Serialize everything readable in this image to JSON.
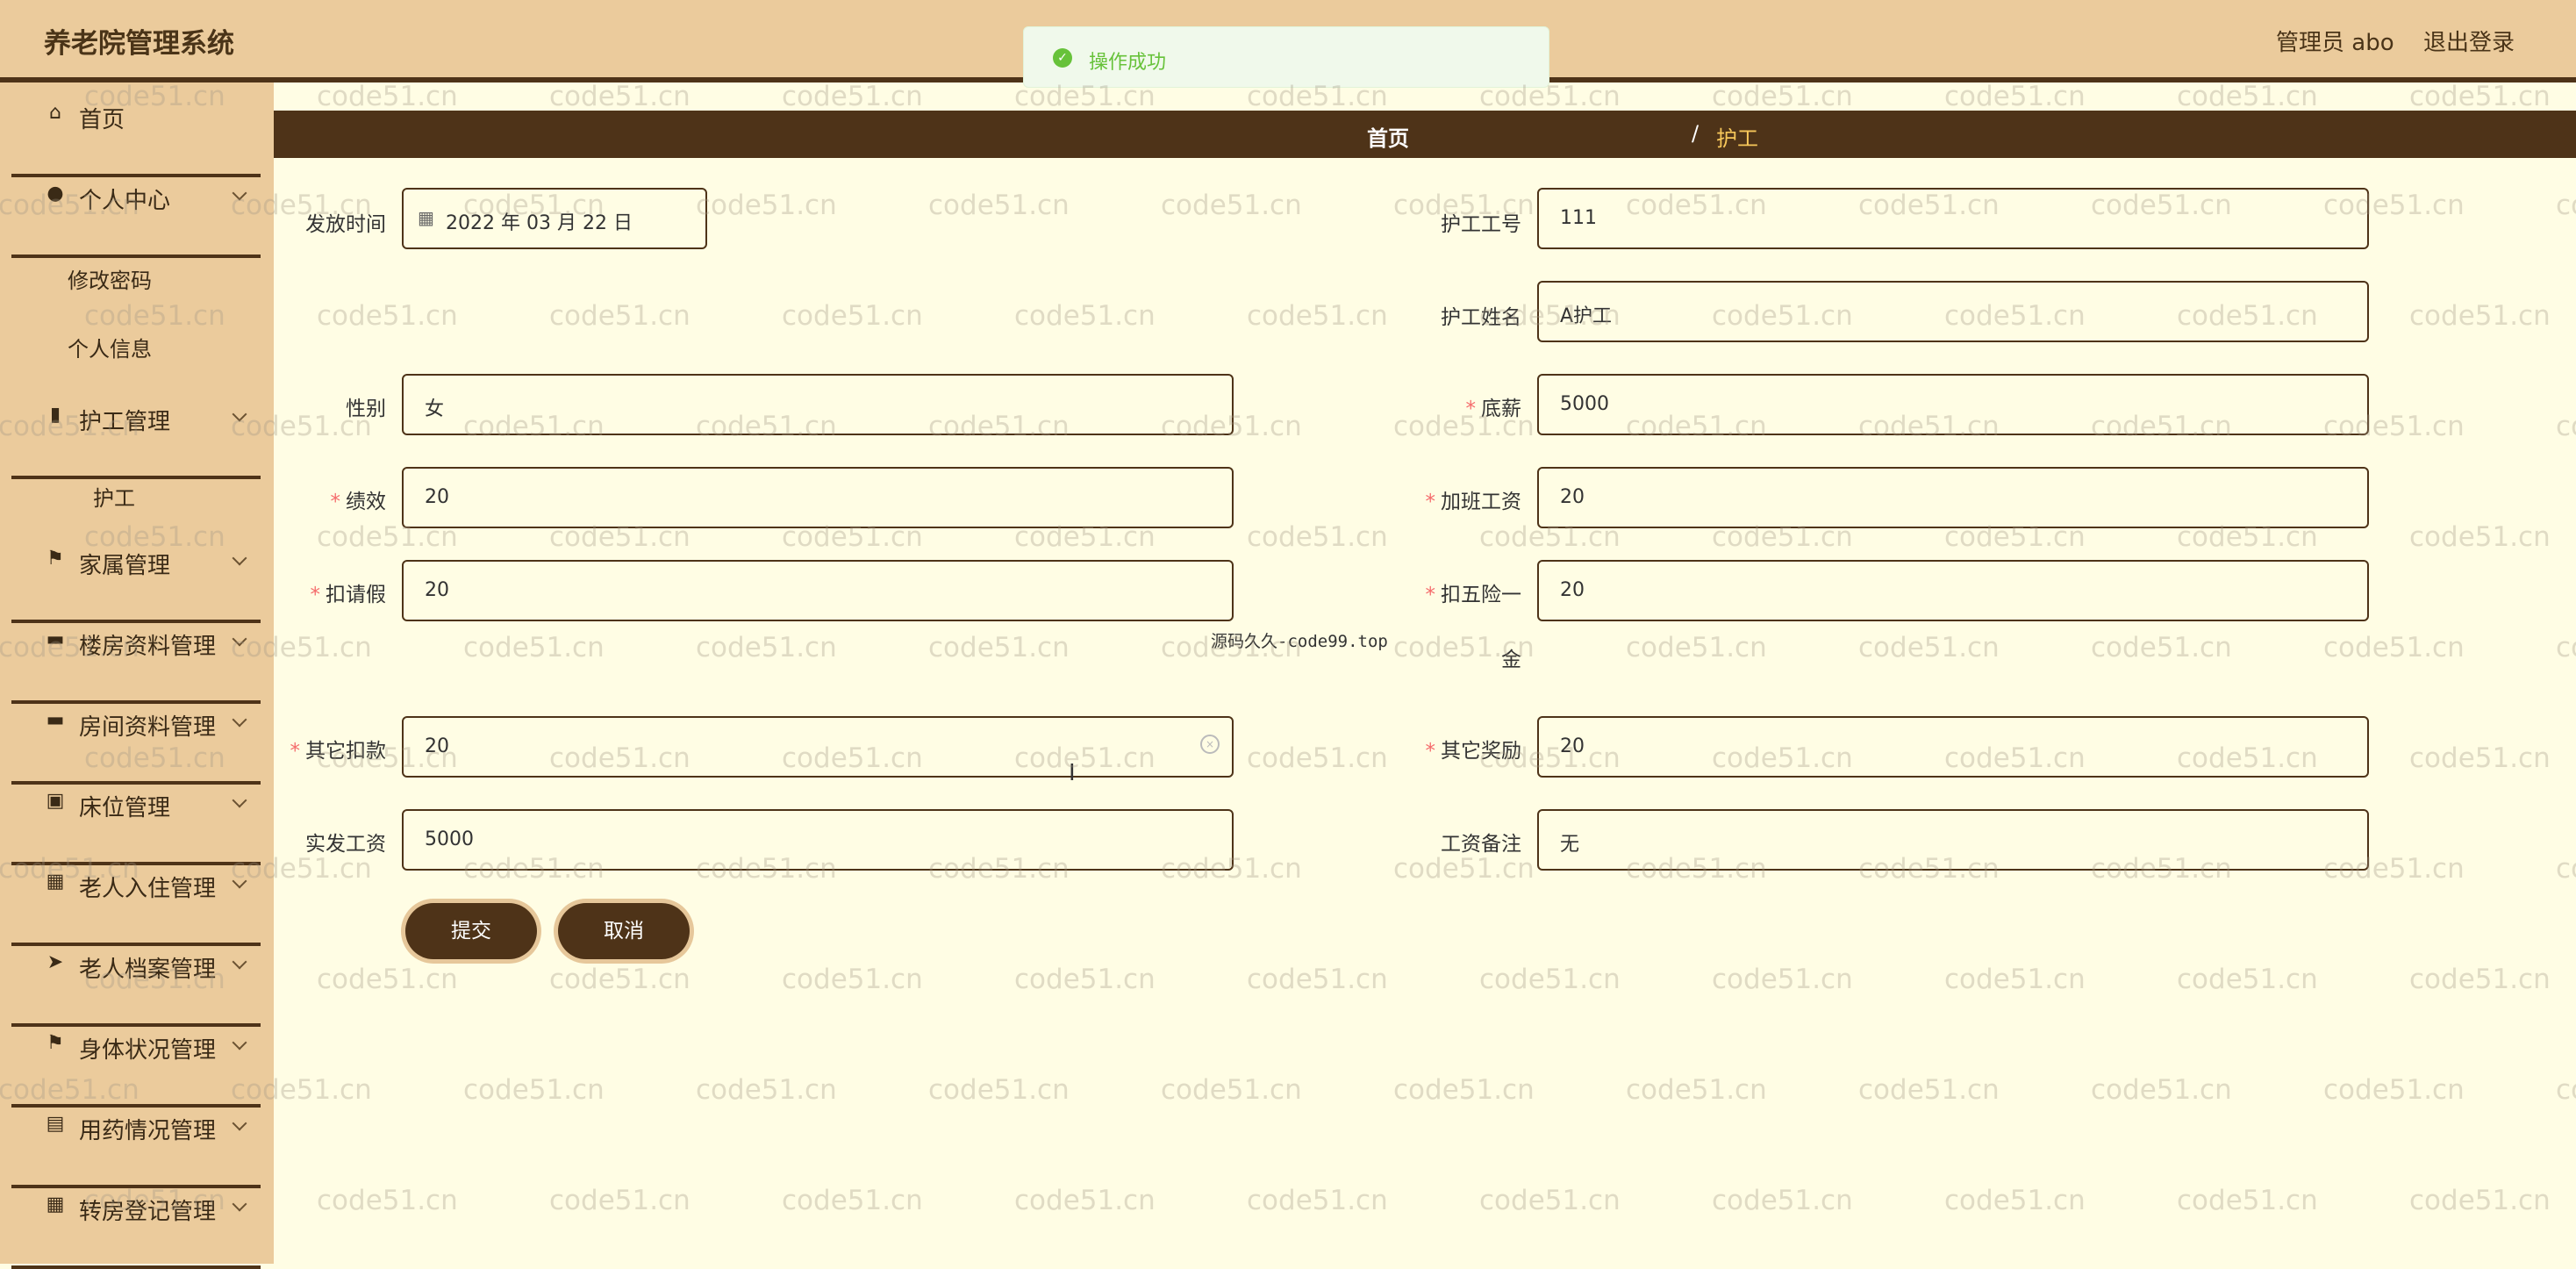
{
  "header": {
    "title": "养老院管理系统",
    "user": "管理员 abo",
    "logout": "退出登录"
  },
  "toast": {
    "text": "操作成功",
    "icon": "check-circle-icon"
  },
  "breadcrumb": {
    "home": "首页",
    "separator": "/",
    "current": "护工"
  },
  "sidebar": {
    "items": [
      {
        "label": "首页",
        "icon": "home-icon"
      },
      {
        "label": "个人中心",
        "icon": "user-icon",
        "sub": [
          "修改密码",
          "个人信息"
        ]
      },
      {
        "label": "护工管理",
        "icon": "bar-chart-icon",
        "sub": [
          "护工"
        ]
      },
      {
        "label": "家属管理",
        "icon": "flag-icon"
      },
      {
        "label": "楼房资料管理",
        "icon": "message-icon"
      },
      {
        "label": "房间资料管理",
        "icon": "monitor-icon"
      },
      {
        "label": "床位管理",
        "icon": "bed-icon"
      },
      {
        "label": "老人入住管理",
        "icon": "grid-icon"
      },
      {
        "label": "老人档案管理",
        "icon": "send-icon"
      },
      {
        "label": "身体状况管理",
        "icon": "flag-icon"
      },
      {
        "label": "用药情况管理",
        "icon": "briefcase-icon"
      },
      {
        "label": "转房登记管理",
        "icon": "grid-icon"
      }
    ]
  },
  "form": {
    "issue_date": {
      "label": "发放时间",
      "value": "2022 年 03 月 22 日"
    },
    "worker_no": {
      "label": "护工工号",
      "value": "111"
    },
    "worker_name": {
      "label": "护工姓名",
      "value": "A护工"
    },
    "gender": {
      "label": "性别",
      "value": "女"
    },
    "base_salary": {
      "label": "底薪",
      "value": "5000"
    },
    "performance": {
      "label": "绩效",
      "value": "20"
    },
    "overtime": {
      "label": "加班工资",
      "value": "20"
    },
    "leave_deduct": {
      "label": "扣请假",
      "value": "20"
    },
    "insurance_deduct": {
      "label": "扣五险一",
      "label_cont": "金",
      "value": "20"
    },
    "other_deduct": {
      "label": "其它扣款",
      "value": "20"
    },
    "other_bonus": {
      "label": "其它奖励",
      "value": "20"
    },
    "net_salary": {
      "label": "实发工资",
      "value": "5000"
    },
    "remark": {
      "label": "工资备注",
      "value": "无"
    },
    "submit": "提交",
    "cancel": "取消"
  },
  "watermark": {
    "text": "code51.cn",
    "center_text": "源码久久-code99.top"
  }
}
